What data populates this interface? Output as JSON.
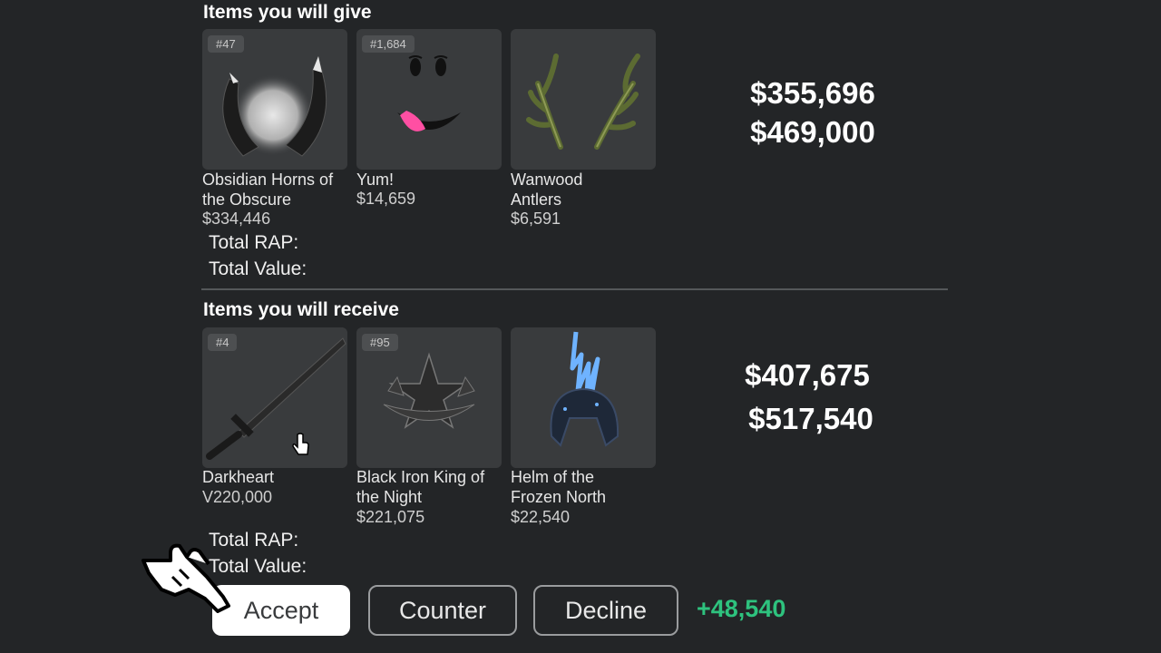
{
  "give": {
    "title": "Items you will give",
    "items": [
      {
        "serial": "#47",
        "name": "Obsidian Horns of the Obscure",
        "price": "$334,446",
        "icon": "obsidian-horns-icon"
      },
      {
        "serial": "#1,684",
        "name": "Yum!",
        "price": "$14,659",
        "icon": "yum-face-icon"
      },
      {
        "serial": "",
        "name": "Wanwood Antlers",
        "price": "$6,591",
        "icon": "wanwood-antlers-icon"
      }
    ],
    "total_rap_label": "Total RAP:",
    "total_value_label": "Total Value:",
    "total_rap": "$355,696",
    "total_value": "$469,000"
  },
  "receive": {
    "title": "Items you will receive",
    "items": [
      {
        "serial": "#4",
        "name": "Darkheart",
        "price": "V220,000",
        "icon": "darkheart-sword-icon"
      },
      {
        "serial": "#95",
        "name": "Black Iron King of the Night",
        "price": "$221,075",
        "icon": "black-iron-crown-icon"
      },
      {
        "serial": "",
        "name": "Helm of the Frozen North",
        "price": "$22,540",
        "icon": "frozen-helm-icon"
      }
    ],
    "total_rap_label": "Total RAP:",
    "total_value_label": "Total Value:",
    "total_rap": "$407,675",
    "total_value": "$517,540"
  },
  "actions": {
    "accept": "Accept",
    "counter": "Counter",
    "decline": "Decline"
  },
  "gain": "+48,540",
  "colors": {
    "background": "#232527",
    "card": "#393b3d",
    "gain": "#2ec27e"
  }
}
